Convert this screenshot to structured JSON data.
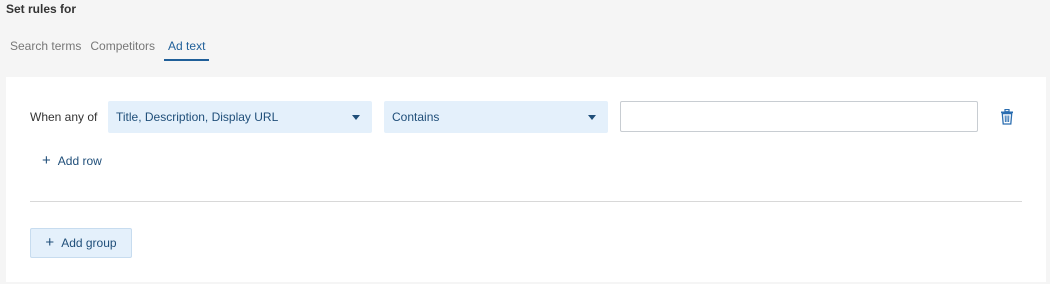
{
  "heading": "Set rules for",
  "tabs": [
    {
      "label": "Search terms",
      "active": false
    },
    {
      "label": "Competitors",
      "active": false
    },
    {
      "label": "Ad text",
      "active": true
    }
  ],
  "rule": {
    "when_label": "When any of",
    "fields_value": "Title, Description, Display URL",
    "operator_value": "Contains",
    "text_value": "",
    "delete_icon": "trash-icon"
  },
  "add_row_label": "Add row",
  "add_group_label": "Add group",
  "colors": {
    "accent": "#1f5f99",
    "select_bg": "#e4f0fb",
    "page_bg": "#f5f5f5"
  }
}
